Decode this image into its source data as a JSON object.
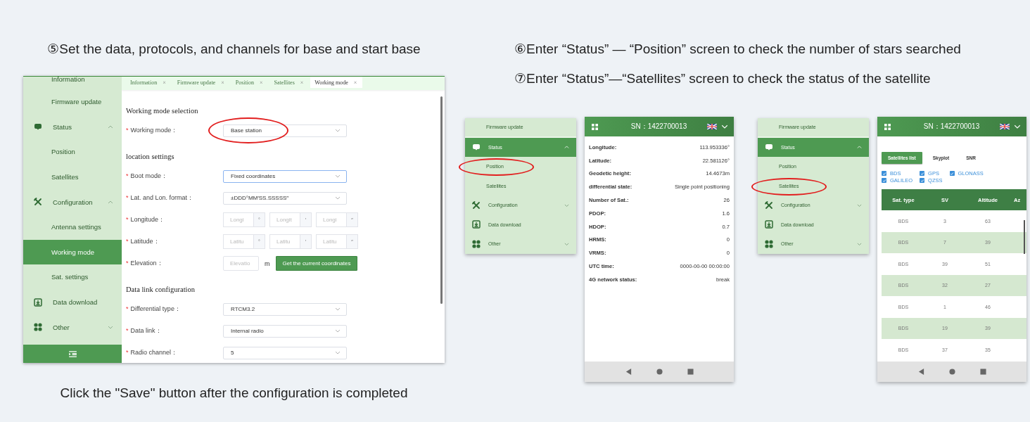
{
  "left": {
    "caption": "⑤Set the data, protocols, and channels for base and start base",
    "window": {
      "sidebar": {
        "items": [
          {
            "label": "Information",
            "kind": "item",
            "selected": false
          },
          {
            "label": "Firmware update",
            "kind": "item",
            "selected": false
          },
          {
            "label": "Status",
            "kind": "group",
            "expanded": true,
            "selected": false
          },
          {
            "label": "Position",
            "kind": "item",
            "selected": false
          },
          {
            "label": "Satellites",
            "kind": "item",
            "selected": false
          },
          {
            "label": "Configuration",
            "kind": "group",
            "expanded": true,
            "selected": false
          },
          {
            "label": "Antenna settings",
            "kind": "item",
            "selected": false
          },
          {
            "label": "Working mode",
            "kind": "item",
            "selected": true
          },
          {
            "label": "Sat. settings",
            "kind": "item",
            "selected": false
          },
          {
            "label": "Data download",
            "kind": "link",
            "selected": false
          },
          {
            "label": "Other",
            "kind": "group",
            "expanded": false,
            "selected": false
          }
        ]
      },
      "tabs": [
        {
          "label": "Information",
          "close": "×",
          "selected": false
        },
        {
          "label": "Firmware update",
          "close": "×",
          "selected": false
        },
        {
          "label": "Position",
          "close": "×",
          "selected": false
        },
        {
          "label": "Satellites",
          "close": "×",
          "selected": false
        },
        {
          "label": "Working mode",
          "close": "×",
          "selected": true
        }
      ],
      "sections": [
        {
          "title": "Working mode selection",
          "fields": [
            {
              "mark": "*",
              "label": "Working mode：",
              "kind": "select",
              "value": "Base station",
              "focused": false,
              "circled": true
            }
          ]
        },
        {
          "title": "location settings",
          "fields": [
            {
              "mark": "*",
              "label": "Boot mode：",
              "kind": "select",
              "value": "Fixed coordinates",
              "focused": true,
              "circled": false
            },
            {
              "mark": "*",
              "label": "Lat. and Lon. format：",
              "kind": "select",
              "value": "±DDD°MM′SS.SSSSS″",
              "focused": false,
              "circled": false
            },
            {
              "mark": "*",
              "label": "Longitude：",
              "kind": "triple",
              "parts": [
                {
                  "placeholder": "Longi",
                  "unit": "°"
                },
                {
                  "placeholder": "Longit",
                  "unit": "′"
                },
                {
                  "placeholder": "Longi",
                  "unit": "″"
                }
              ],
              "circled": false
            },
            {
              "mark": "*",
              "label": "Latitude：",
              "kind": "triple",
              "parts": [
                {
                  "placeholder": "Latitu",
                  "unit": "°"
                },
                {
                  "placeholder": "Latitu",
                  "unit": "′"
                },
                {
                  "placeholder": "Latitu",
                  "unit": "″"
                }
              ],
              "circled": false
            },
            {
              "mark": "*",
              "label": "Elevation：",
              "kind": "elevation",
              "placeholder": "Elevatio",
              "unit": "m",
              "button": "Get the current coordinates",
              "circled": false
            }
          ]
        },
        {
          "title": "Data link configuration",
          "fields": [
            {
              "mark": "*",
              "label": "Differential type：",
              "kind": "select",
              "value": "RTCM3.2",
              "focused": false,
              "circled": false
            },
            {
              "mark": "*",
              "label": "Data link：",
              "kind": "select",
              "value": "Internal radio",
              "focused": false,
              "circled": false
            },
            {
              "mark": "*",
              "label": "Radio channel：",
              "kind": "select",
              "value": "5",
              "focused": false,
              "circled": false
            }
          ]
        }
      ]
    },
    "footnote": "Click the \"Save\" button after the configuration is completed"
  },
  "right": {
    "captions": [
      "⑥Enter “Status” — “Position” screen to check the number of stars searched",
      "⑦Enter “Status”—“Satellites” screen to check the status of the satellite"
    ],
    "panels": [
      {
        "kind": "position",
        "menu": {
          "items": [
            {
              "label": "Firmware update",
              "kind": "item",
              "selected": false,
              "circled": false
            },
            {
              "label": "Status",
              "kind": "group",
              "expanded": true,
              "selected": true,
              "circled": false
            },
            {
              "label": "Position",
              "kind": "item",
              "selected": false,
              "circled": true
            },
            {
              "label": "Satellites",
              "kind": "item",
              "selected": false,
              "circled": false
            },
            {
              "label": "Configuration",
              "kind": "group",
              "expanded": false,
              "selected": false,
              "circled": false
            },
            {
              "label": "Data download",
              "kind": "link",
              "selected": false,
              "circled": false
            },
            {
              "label": "Other",
              "kind": "group",
              "expanded": false,
              "selected": false,
              "circled": false
            }
          ]
        },
        "phone": {
          "sn": "SN：1422700013",
          "rows": [
            {
              "label": "Longitude:",
              "value": "113.953336°"
            },
            {
              "label": "Latitude:",
              "value": "22.581126°"
            },
            {
              "label": "Geodetic height:",
              "value": "14.4673m"
            },
            {
              "label": "differential state:",
              "value": "Single point positioning"
            },
            {
              "label": "Number of Sat.:",
              "value": "26"
            },
            {
              "label": "PDOP:",
              "value": "1.6"
            },
            {
              "label": "HDOP:",
              "value": "0.7"
            },
            {
              "label": "HRMS:",
              "value": "0"
            },
            {
              "label": "VRMS:",
              "value": "0"
            },
            {
              "label": "UTC time:",
              "value": "0000-00-00 00:00:00"
            },
            {
              "label": "4G network status:",
              "value": "break"
            }
          ]
        }
      },
      {
        "kind": "satellites",
        "menu": {
          "items": [
            {
              "label": "Firmware update",
              "kind": "item",
              "selected": false,
              "circled": false
            },
            {
              "label": "Status",
              "kind": "group",
              "expanded": true,
              "selected": true,
              "circled": false
            },
            {
              "label": "Position",
              "kind": "item",
              "selected": false,
              "circled": false
            },
            {
              "label": "Satellites",
              "kind": "item",
              "selected": false,
              "circled": true
            },
            {
              "label": "Configuration",
              "kind": "group",
              "expanded": false,
              "selected": false,
              "circled": false
            },
            {
              "label": "Data download",
              "kind": "link",
              "selected": false,
              "circled": false
            },
            {
              "label": "Other",
              "kind": "group",
              "expanded": false,
              "selected": false,
              "circled": false
            }
          ]
        },
        "phone": {
          "sn": "SN：1422700013",
          "view_tabs": [
            {
              "label": "Satellites list",
              "selected": true
            },
            {
              "label": "Skyplot",
              "selected": false
            },
            {
              "label": "SNR",
              "selected": false
            }
          ],
          "filters": [
            {
              "label": "BDS",
              "checked": true
            },
            {
              "label": "GPS",
              "checked": true
            },
            {
              "label": "GLONASS",
              "checked": true
            },
            {
              "label": "GALILEO",
              "checked": true
            },
            {
              "label": "QZSS",
              "checked": true
            }
          ],
          "table": {
            "columns": [
              "Sat. type",
              "SV",
              "Altitude",
              "Az"
            ],
            "rows": [
              [
                "BDS",
                "3",
                "63"
              ],
              [
                "BDS",
                "7",
                "39"
              ],
              [
                "BDS",
                "39",
                "51"
              ],
              [
                "BDS",
                "32",
                "27"
              ],
              [
                "BDS",
                "1",
                "46"
              ],
              [
                "BDS",
                "19",
                "39"
              ],
              [
                "BDS",
                "37",
                "35"
              ]
            ]
          }
        }
      }
    ]
  }
}
